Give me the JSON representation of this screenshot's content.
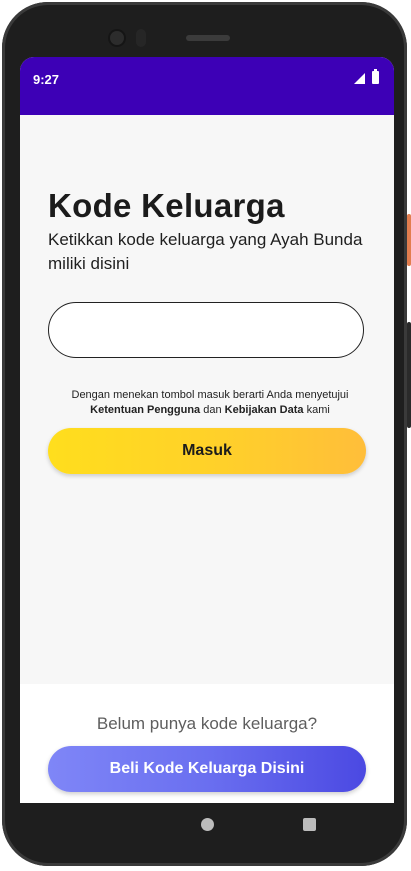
{
  "status_bar": {
    "time": "9:27",
    "icons": [
      "signal-icon",
      "battery-icon"
    ],
    "color": "#3d00b6"
  },
  "main": {
    "title": "Kode Keluarga",
    "subtitle": "Ketikkan kode keluarga yang Ayah Bunda miliki disini",
    "code_input": {
      "value": "",
      "placeholder": ""
    },
    "terms": {
      "prefix": "Dengan menekan tombol masuk berarti Anda menyetujui",
      "link_terms": "Ketentuan Pengguna",
      "connector": "dan",
      "link_privacy": "Kebijakan Data",
      "suffix": "kami"
    },
    "login_button": {
      "label": "Masuk",
      "color": "#ffd02a"
    }
  },
  "bottom": {
    "question": "Belum punya kode keluarga?",
    "buy_button": {
      "label": "Beli Kode Keluarga Disini",
      "color": "#5b5ee9"
    }
  },
  "nav_bar": {
    "icons": [
      "home-icon",
      "recents-icon"
    ]
  }
}
